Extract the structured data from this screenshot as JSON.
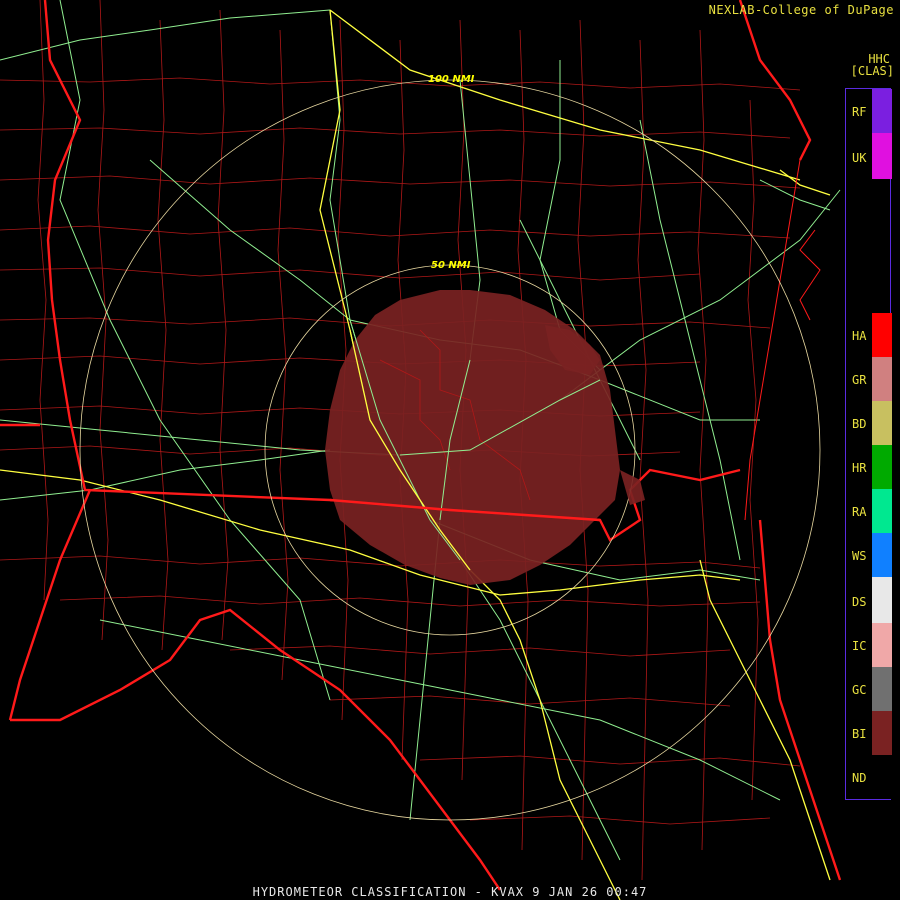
{
  "header": {
    "credit": "NEXLAB-College of DuPage",
    "product_code": "HHC",
    "legend_title": "[CLAS]"
  },
  "range_rings": [
    {
      "label": "50 NMI"
    },
    {
      "label": "100 NMI"
    }
  ],
  "legend": [
    {
      "code": "RF",
      "color": "#7b1fe0"
    },
    {
      "code": "UK",
      "color": "#e010e0"
    },
    {
      "code": "HA",
      "color": "#ff0000"
    },
    {
      "code": "GR",
      "color": "#d08080"
    },
    {
      "code": "BD",
      "color": "#c8c060"
    },
    {
      "code": "HR",
      "color": "#00aa00"
    },
    {
      "code": "RA",
      "color": "#00e890"
    },
    {
      "code": "WS",
      "color": "#1080ff"
    },
    {
      "code": "DS",
      "color": "#e8e8e8"
    },
    {
      "code": "IC",
      "color": "#f0a8a8"
    },
    {
      "code": "GC",
      "color": "#707070"
    },
    {
      "code": "BI",
      "color": "#7a2222"
    },
    {
      "code": "ND",
      "color": "#000000"
    }
  ],
  "footer": {
    "caption": "HYDROMETEOR CLASSIFICATION - KVAX 9 JAN 26 00:47"
  },
  "colors": {
    "state_border": "#ff1a1a",
    "county_border": "#b01818",
    "interstate": "#ffff40",
    "highway": "#90ee90",
    "range_ring": "#e8d8a0",
    "echo": "#7a2222"
  }
}
